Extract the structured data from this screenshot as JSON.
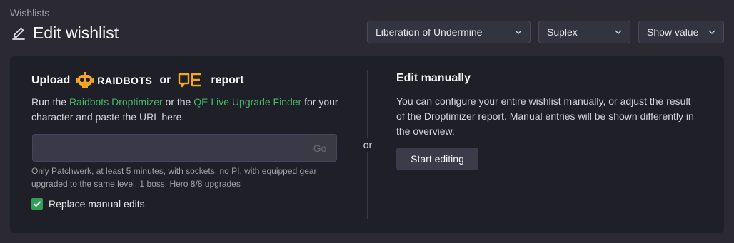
{
  "header": {
    "breadcrumb": "Wishlists",
    "title": "Edit wishlist"
  },
  "selects": {
    "raid": "Liberation of Undermine",
    "character": "Suplex",
    "mode": "Show value"
  },
  "upload": {
    "prefix": "Upload",
    "raidbots_logo_text": "RAIDBOTS",
    "or_word": "or",
    "qe_logo_text": "QE",
    "suffix": "report",
    "text_1": "Run the ",
    "link_raidbots": "Raidbots Droptimizer",
    "text_2": " or the ",
    "link_qe": "QE Live Upgrade Finder",
    "text_3": " for your character and paste the URL here.",
    "input_value": "",
    "input_placeholder": "",
    "go_label": "Go",
    "hint": "Only Patchwerk, at least 5 minutes, with sockets, no PI, with equipped gear upgraded to the same level, 1 boss, Hero 8/8 upgrades",
    "checkbox_label": "Replace manual edits",
    "checkbox_checked": true
  },
  "separator_label": "or",
  "manual": {
    "heading": "Edit manually",
    "description": "You can configure your entire wishlist manually, or adjust the result of the Droptimizer report. Manual entries will be shown differently in the overview.",
    "button_label": "Start editing"
  },
  "colors": {
    "background": "#2b2a33",
    "panel": "#1f1f27",
    "link": "#43b86a",
    "checkbox": "#2f9e57",
    "raidbots_accent": "#f5a623"
  }
}
